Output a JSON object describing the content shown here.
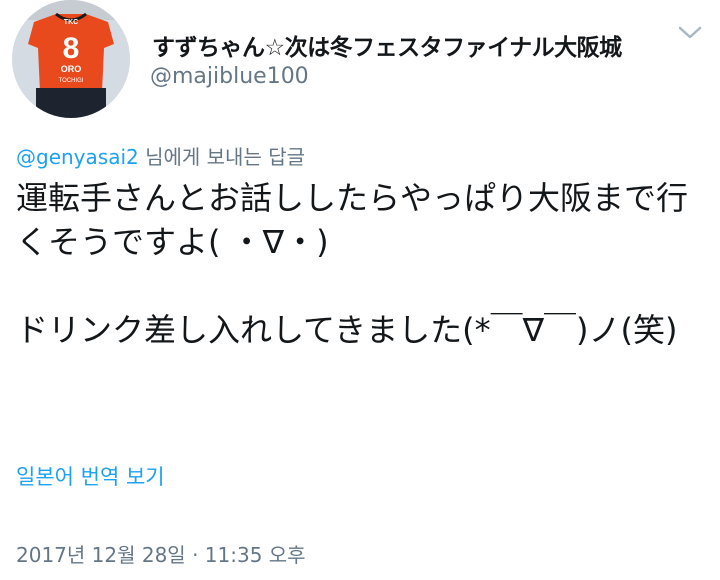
{
  "author": {
    "display_name": "すずちゃん☆次は冬フェスタファイナル大阪城",
    "handle": "@majiblue100",
    "avatar_icon": "avatar-photo-jersey",
    "avatar_jersey_number": "8",
    "avatar_jersey_text": "ORO",
    "avatar_jersey_sub": "TOCHIGI",
    "avatar_brand": "TKC"
  },
  "menu": {
    "icon": "chevron-down-icon"
  },
  "reply": {
    "mention": "@genyasai2",
    "suffix": " 님에게 보내는 답글"
  },
  "tweet": {
    "text": "運転手さんとお話ししたらやっぱり大阪まで行くそうですよ( ・∇・)\n\nドリンク差し入れしてきました(*￣∇￣)ノ(笑)"
  },
  "translate_link": "일본어 번역 보기",
  "timestamp": "2017년 12월 28일 · 11:35 오후",
  "colors": {
    "text": "#14171a",
    "secondary": "#657786",
    "link": "#1da1f2",
    "jersey": "#e8491d"
  }
}
